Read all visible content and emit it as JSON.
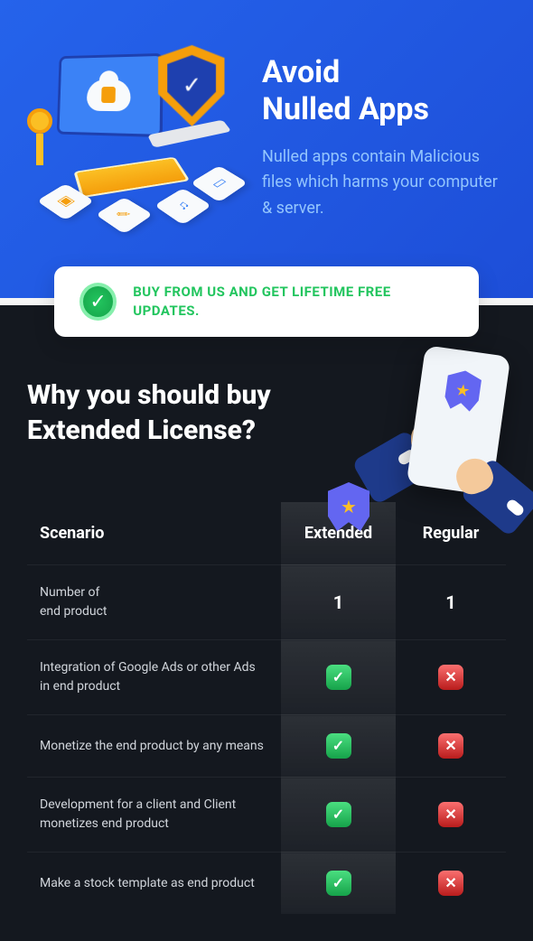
{
  "hero": {
    "title": "Avoid\nNulled Apps",
    "description": "Nulled apps contain Malicious files which harms your computer & server."
  },
  "badge": {
    "text": "BUY FROM US AND GET LIFETIME FREE UPDATES."
  },
  "license": {
    "title": "Why you should buy Extended License?"
  },
  "table": {
    "headers": {
      "scenario": "Scenario",
      "extended": "Extended",
      "regular": "Regular"
    },
    "rows": [
      {
        "scenario": "Number of\nend product",
        "extended": "1",
        "regular": "1",
        "type": "text"
      },
      {
        "scenario": "Integration of Google Ads or other Ads in end product",
        "extended": "yes",
        "regular": "no",
        "type": "check"
      },
      {
        "scenario": "Monetize the end product by any means",
        "extended": "yes",
        "regular": "no",
        "type": "check"
      },
      {
        "scenario": "Development for a client and Client monetizes end product",
        "extended": "yes",
        "regular": "no",
        "type": "check"
      },
      {
        "scenario": "Make a stock template as end product",
        "extended": "yes",
        "regular": "no",
        "type": "check"
      }
    ]
  }
}
